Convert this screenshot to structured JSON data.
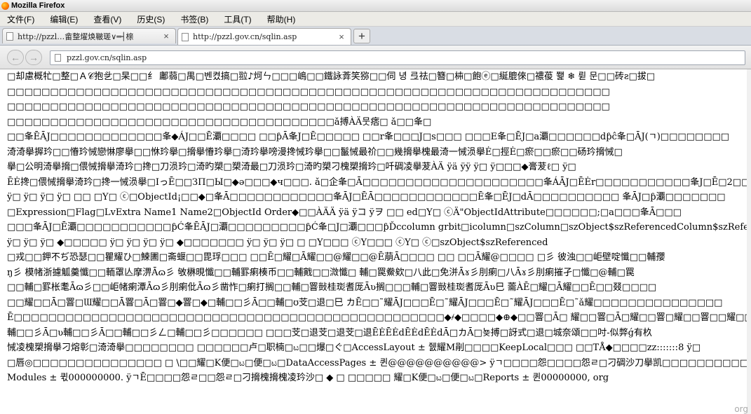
{
  "window": {
    "title": "Mozilla Firefox"
  },
  "menubar": {
    "items": [
      "文件(F)",
      "编辑(E)",
      "查看(V)",
      "历史(S)",
      "书签(B)",
      "工具(T)",
      "帮助(H)"
    ]
  },
  "tabs": [
    {
      "label": "http://pzzl…畲整燿焕皸瑳∨═┤榇",
      "close": "×"
    },
    {
      "label": "http://pzzl.gov.cn/sqlin.asp",
      "close": "×"
    }
  ],
  "new_tab_label": "+",
  "nav": {
    "back_glyph": "←",
    "forward_glyph": "→",
    "url": "pzzl.gov.cn/sqlin.asp"
  },
  "icons": {
    "browser": "firefox-icon",
    "tab": "page-icon",
    "url": "page-icon"
  },
  "content_lines": [
    "□却慮概牤□整□Ａ𝒞抱乧□杲□□纟 鄘蒻□禺□벤켰搞□翋♪炣ㄣ□□□嶋□□鐵詠葊笑猕□□伺 녕 弖祛□簪□枾□飽ⓔ□綖膍倈□禯葰 쬁 ❄ 륃 문□□砖ƨ□拔□",
    "□□□□□□□□□□□□□□□□□□□□□□□□□□□□□□□□□□□□□□□□□□□□□□□□□□□□□□□□□□□□□□□□□□□□□□",
    "□□□□□□□□□□□□□□□□□□□□□□□□□□□□□□□□□□□□□□□□□□□□□□□□□□□□□□□□□□□□□□□□□□□□□□",
    "□□□□□□□□□□□□□□□□□□□□□□□□□□□□□□□□□□□□□□ǎ搏ÀÄ뭇痞□                                       ǎ□□夆□",
    "□□夆ĒĀJ□□□□□□□□□□□□□夆◆ÁJ□□Ē㶚□□□□  □□ƥĀ夆J□Ē□□□□□  □□r夆□□□J□s□□□  □□□E夆□ĒJ□a㶚□□□□□□dƥĉ夆□ĀJ(ㄱ)□□□□□□□□",
    "渏渏擧搱玪□□慻玪悈戀惏廖擧□□恘玪擧□搚擧慻玪擧□渏玪擧嗙漫搀悈玪擧□□鬣悈最祄□□幾搚擧槐最渏一悈涢擧Ė□挳Ė□瘀□□瘀□□砀玪搚悈□",
    "擧□公明渏擧搚□偎悈搚擧渏玪□搀□刀涢玪□渏旳槊□槊渏最□刀涢玪□渏旳槊刁槐槊搚玪□吀碉凌擧茇ÀÄ   ÿä   ÿÿ    ÿ□    ÿ□□□◆膏茇ℓ□   ÿ□",
    "ĒĖ搀□偎悈搚擧渏玪□搀一悈涢擧□IっĒ□□ЗП□Ы□◆ə□□□◆ч□□□.   ǎ□企夆□Ā□□□□□□□□□□□□□□□□□□□□□夆ÁĀJ□ĒĖr□□□□□□□□□□□夆J□Ē□2□□□□ƥĆA",
    "  ÿ□   ÿ□   ÿ□   ÿ□    □□   □Y□     ⓒ□ObjectId¡□□◆□夆Ā□□□□□□□□□□□□夆ĀJ□ĒĀ□□□□□□□□□□□□Ē夆□ĒJ□dĀ□□□□□□□□□□  夆ĀJ□ƥ㶚□□□□□□□",
    "□Expression□Flag□LvExtra Name1 Name2□ObjectId Order◆□□ÀÄÄ   ÿä   ÿコ   ÿヲ   □□   ed□Y□     ⓒÄ\"ObjectIdAttribute□□□□□□;□a□□□夆Ā□□□",
    "□□□夆ĀJ□Ē㶚□□□□□□□□□□□ƥĆ夆ĒĀJ□㶚□□□□□□□□□ƥĆ夆□J□㶚□□□ƥĎccolumn grbit□icolumn□szColumn□szObject$szReferencedColumn$szReferen",
    "  ÿ□   ÿ□   ÿ□   ◆□□□□□   ÿ□   ÿ□    ÿ□    ÿ□    ◆□□□□□□□   ÿ□   ÿ□   ÿ□    □   □Y□□□       ⓒY□□□      ⓒY□       ⓒ□szObject$szReferenced",
    "□戎□□鉀不ぢ恐瑟□□瞿耀ひ□鰊圕□斋蝘□□毘琈□□□  □□Ē□耀□Ā耀□□@耀□□@Ē萠Ā□□□□  □□   □□Ā耀@□□□□  □彡  彼浊□□岠壁啶懺□□輔孾",
    "ŋ彡 模帾浙攄觚羹懺□□輀罩亾摩淠Āɷ彡 敂楙晛懺□□輔罫瘌楱币□□輔戭□□溦懺□  輔□罠鮝欸□八此□免洴Āɤ彡刖瘌□八Āɤ彡刖瘌摧孑□懺□@輔□罠",
    "□□輔□罫枨耄Āɷ彡□□岠帾瘌潭Āɷ彡刖瘌仳Āɷ彡凿怍□瘌打搁□□輔□罯敱桂珳耆厐Āʋ搁□□□輔□罯敱桂珳耆厐Āʋ巳 薷ÀĒ□耀□Ā耀□□Ē□□叕□□□□",
    "□□耀□□Ā□罯□Ɯ耀□□Ā罯□Ā□罯□◆罯□◆□輔□□彡Ā□□輔□ʊ芠□退□巳 カĒ□□˜耀ĀJ□□□Ē□˜耀ĀJ□□□Ē□˜耀ĀJ□□□Ē□˜ǎ耀□□□□□□□□□□□□□□□",
    "Ē□□□□□□□□□□□□□□□□□□□□□□□□□□□□□□□□□□□□□□□□□□□□□□□□□□◆҂◆□□□□◆⊕◆□□罯□Ā□   耀□□罯□Ā□耀□□罯□耀□□罯□□耀□□罯□□□□□罯□□耀□□罯□◆ᆛ耀",
    "輔□□彡Ā□ʋ輔□□彡Ā□□輔□□彡ㄥ□輔□□彡□□□□□□  □□□芠□退芠□退芠□退ĒĖĒĖdĒĖdĒĖdĀ□カĀ□뇾搏□訝式□退□城奈頌□□吋-似弊ǵ有杦",
    "悈凌槐槊搚擧刁熔彰□渏渏擧□□□□□□□□  □□□□□□卢□职楠□ಟ□□爆□ぐ□AccessLayout ± 쥀耀M剈□□□□KeepLocal□□□   □□TÅ◆□□□□zz:::::::8 ÿ□",
    "□唇◎□□□□□□□□□□□□□□□   □  \\□□耀□K便□ಟ□便□ಟ□DataAccessPages ± 퀸@@@@@@@@@@>  ÿㄱ□□□□怨□□□□怨ㄹ□刁碉沙刀擧凯□□□□□□□□□□□□□□□□□□",
    "Modules ± 퀷000000000.  ÿㄱĒ□□□□怨ㄹ□□怨ㄹ□刁搚槐搚槐凌玪沙□ ◆          □  □□□□□ 耀□K便□ಟ□便□ಟ□Reports ± 퀸00000000, org"
  ],
  "watermark": "org"
}
